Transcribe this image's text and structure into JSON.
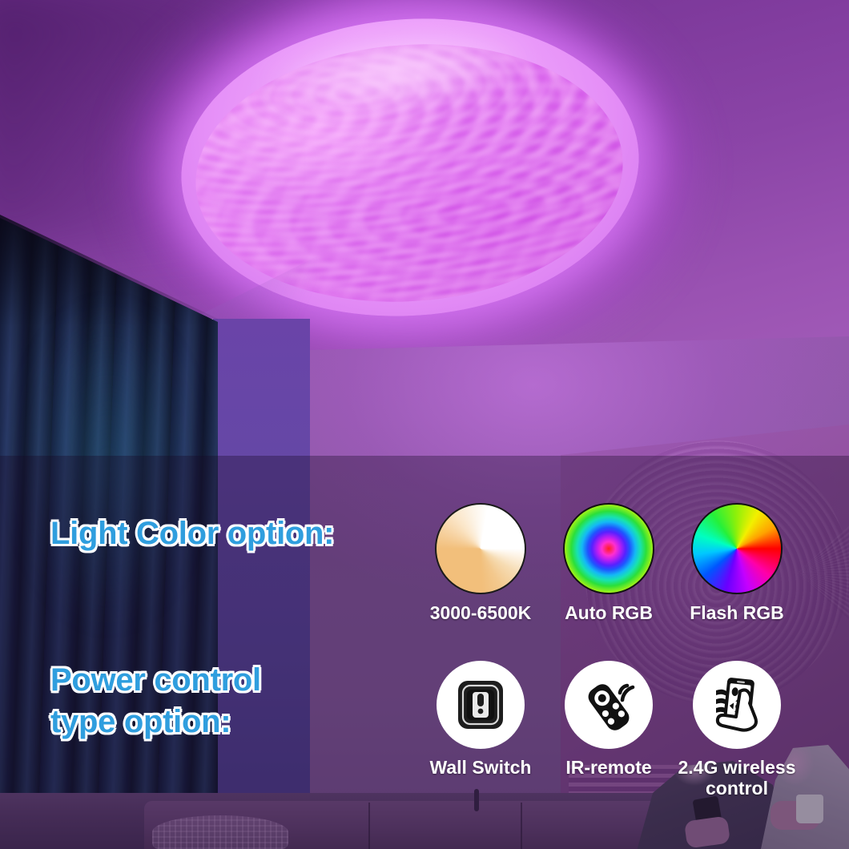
{
  "product": {
    "scene_description": "Ceiling LED light glowing purple in a living room"
  },
  "headings": {
    "light_color": "Light Color option:",
    "power_control_line1": "Power control",
    "power_control_line2": "type option:"
  },
  "light_color_options": [
    {
      "id": "cct",
      "label": "3000-6500K",
      "icon": "color-temperature-wheel-icon"
    },
    {
      "id": "auto_rgb",
      "label": "Auto RGB",
      "icon": "concentric-rainbow-icon"
    },
    {
      "id": "flash_rgb",
      "label": "Flash RGB",
      "icon": "color-wheel-icon"
    }
  ],
  "power_control_options": [
    {
      "id": "wall_switch",
      "label": "Wall Switch",
      "icon": "wall-switch-icon"
    },
    {
      "id": "ir_remote",
      "label": "IR-remote",
      "icon": "ir-remote-icon"
    },
    {
      "id": "wireless",
      "label": "2.4G wireless\ncontrol",
      "icon": "phone-in-hand-icon"
    }
  ],
  "colors": {
    "heading_text": "#2f9ede",
    "heading_outline": "#ffffff",
    "caption_text": "#ffffff",
    "icon_circle_bg": "#ffffff",
    "lamp_glow": "#e58ff7",
    "wall": "#8d5aa6",
    "curtain": "#243262"
  }
}
